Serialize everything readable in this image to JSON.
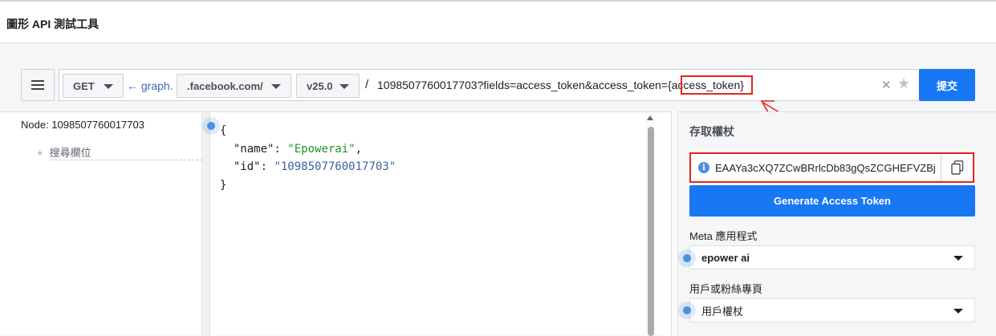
{
  "header": {
    "title": "圖形 API 測試工具"
  },
  "toolbar": {
    "method": "GET",
    "graph_prefix": "← graph.",
    "domain": ".facebook.com/",
    "version": "v25.0",
    "slash": "/",
    "path_before": "1098507760017703?fields=access_token&access_token={",
    "path_highlight": "access_token",
    "path_after": "}",
    "submit_label": "提交"
  },
  "left_panel": {
    "node_label": "Node:  1098507760017703",
    "add_field_plus": "+",
    "add_field_label": "搜尋欄位"
  },
  "editor": {
    "lines": {
      "open": "{",
      "name_key": "  \"name\": ",
      "name_val": "\"Epowerai\"",
      "name_comma": ",",
      "id_key": "  \"id\": ",
      "id_val": "\"1098507760017703\"",
      "close": "}"
    }
  },
  "right_panel": {
    "title": "存取權杖",
    "token_info_icon": "i",
    "token_value": "EAAYa3cXQ7ZCwBRrlcDb83gQsZCGHEFVZBj",
    "generate_label": "Generate Access Token",
    "app_label": "Meta 應用程式",
    "app_value": "epower ai",
    "user_label": "用戶或粉絲專頁",
    "user_value": "用戶權杖"
  },
  "colors": {
    "accent": "#1877f2",
    "annotation_red": "#e3241e"
  },
  "icons": [
    "menu-icon",
    "caret-down-icon",
    "clear-icon",
    "star-icon",
    "info-icon",
    "copy-icon"
  ]
}
